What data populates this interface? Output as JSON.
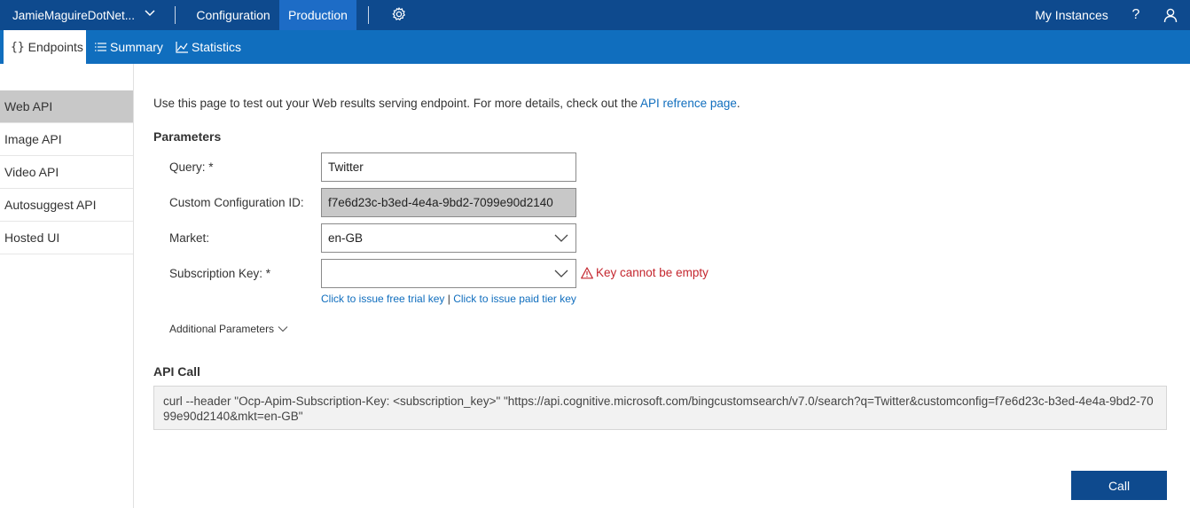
{
  "topbar": {
    "instance_name": "JamieMaguireDotNet...",
    "nav_configuration": "Configuration",
    "nav_production": "Production",
    "my_instances": "My Instances",
    "help": "?"
  },
  "subnav": {
    "endpoints_icon": "{}",
    "endpoints": "Endpoints",
    "summary": "Summary",
    "statistics": "Statistics"
  },
  "sidebar": {
    "items": [
      {
        "label": "Web API",
        "active": true
      },
      {
        "label": "Image API",
        "active": false
      },
      {
        "label": "Video API",
        "active": false
      },
      {
        "label": "Autosuggest API",
        "active": false
      },
      {
        "label": "Hosted UI",
        "active": false
      }
    ]
  },
  "main": {
    "intro_text": "Use this page to test out your Web results serving endpoint. For more details, check out the ",
    "intro_link": "API refrence page",
    "intro_end": ".",
    "parameters_title": "Parameters",
    "query_label": "Query: *",
    "query_value": "Twitter",
    "config_label": "Custom Configuration ID:",
    "config_value": "f7e6d23c-b3ed-4e4a-9bd2-7099e90d2140",
    "market_label": "Market:",
    "market_value": "en-GB",
    "subkey_label": "Subscription Key: *",
    "subkey_value": "",
    "subkey_error": "Key cannot be empty",
    "free_key_link": "Click to issue free trial key",
    "link_separator": "|",
    "paid_key_link": "Click to issue paid tier key",
    "additional_params": "Additional Parameters",
    "api_call_title": "API Call",
    "api_call_text": "curl --header \"Ocp-Apim-Subscription-Key: <subscription_key>\" \"https://api.cognitive.microsoft.com/bingcustomsearch/v7.0/search?q=Twitter&customconfig=f7e6d23c-b3ed-4e4a-9bd2-7099e90d2140&mkt=en-GB\"",
    "call_button": "Call"
  },
  "colors": {
    "topbar_bg": "#0e4a8e",
    "subnav_bg": "#106ebe",
    "active_nav": "#1d6cc6",
    "error": "#c4262e",
    "link": "#106ebe"
  },
  "icons": [
    "chevron-down-icon",
    "gear-icon",
    "question-icon",
    "user-icon",
    "list-icon",
    "chart-icon",
    "warning-icon"
  ]
}
